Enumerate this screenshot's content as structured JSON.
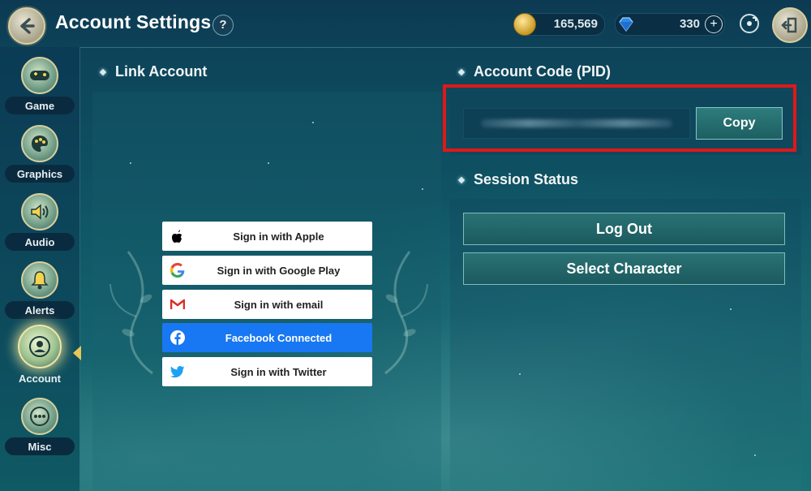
{
  "header": {
    "title": "Account Settings",
    "help": "?",
    "gold": "165,569",
    "gems": "330",
    "plus": "+"
  },
  "sidebar": {
    "items": [
      {
        "label": "Game",
        "icon": "gamepad-icon"
      },
      {
        "label": "Graphics",
        "icon": "palette-icon"
      },
      {
        "label": "Audio",
        "icon": "speaker-icon"
      },
      {
        "label": "Alerts",
        "icon": "bell-icon"
      },
      {
        "label": "Account",
        "icon": "user-icon",
        "active": true
      },
      {
        "label": "Misc",
        "icon": "more-icon"
      }
    ]
  },
  "link_account": {
    "title": "Link Account",
    "buttons": [
      {
        "label": "Sign in with Apple",
        "icon": "apple-icon"
      },
      {
        "label": "Sign in with Google Play",
        "icon": "google-icon"
      },
      {
        "label": "Sign in with email",
        "icon": "gmail-icon"
      },
      {
        "label": "Facebook Connected",
        "icon": "facebook-icon"
      },
      {
        "label": "Sign in with Twitter",
        "icon": "twitter-icon"
      }
    ]
  },
  "account_code": {
    "title": "Account Code (PID)",
    "copy_label": "Copy"
  },
  "session": {
    "title": "Session Status",
    "logout_label": "Log Out",
    "select_character_label": "Select Character"
  },
  "colors": {
    "highlight": "#e01818",
    "facebook": "#1877f2",
    "accent": "#e8c75a"
  }
}
